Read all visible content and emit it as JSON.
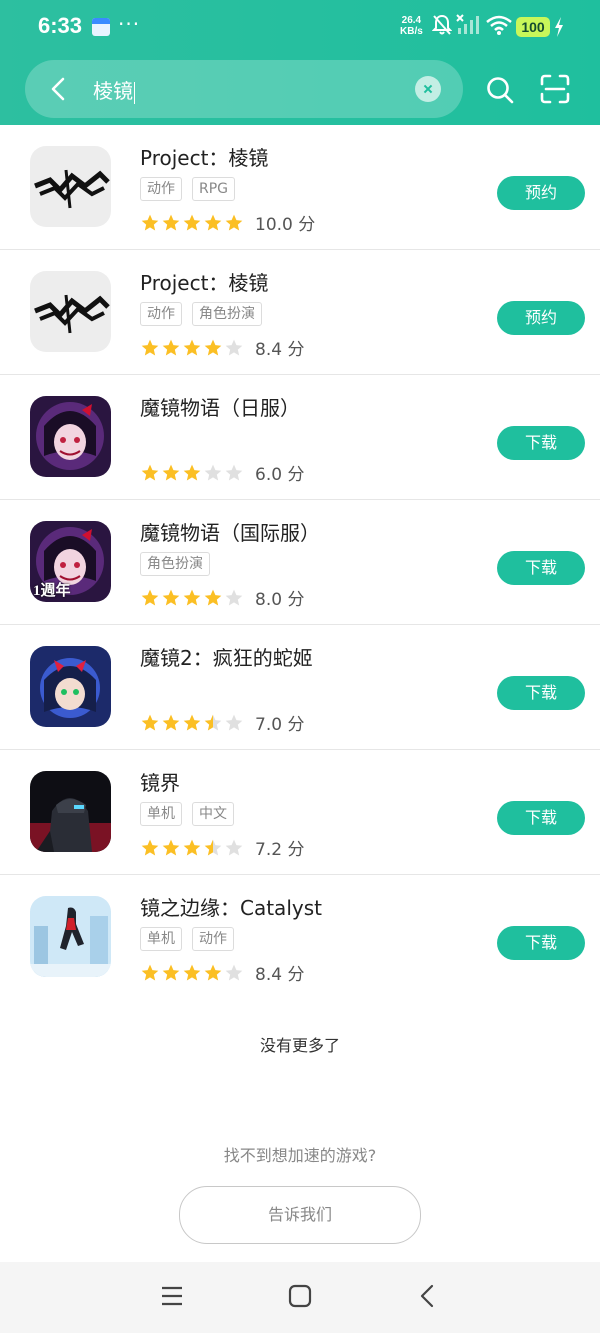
{
  "status_bar": {
    "time": "6:33",
    "more": "···",
    "net_speed_value": "26.4",
    "net_speed_unit": "KB/s",
    "battery": "100"
  },
  "search": {
    "query": "棱镜"
  },
  "results": [
    {
      "name": "Project：棱镜",
      "tags": [
        "动作",
        "RPG"
      ],
      "stars": 5,
      "score": "10.0 分",
      "action": "预约",
      "icon": "prism-logo-icon"
    },
    {
      "name": "Project：棱镜",
      "tags": [
        "动作",
        "角色扮演"
      ],
      "stars": 4,
      "score": "8.4 分",
      "action": "预约",
      "icon": "prism-logo-icon"
    },
    {
      "name": "魔镜物语（日服）",
      "tags": [],
      "stars": 3,
      "score": "6.0 分",
      "action": "下载",
      "icon": "mirror-tale-icon"
    },
    {
      "name": "魔镜物语（国际服）",
      "tags": [
        "角色扮演"
      ],
      "stars": 4,
      "score": "8.0 分",
      "action": "下载",
      "icon": "mirror-tale-anniversary-icon"
    },
    {
      "name": "魔镜2：疯狂的蛇姬",
      "tags": [],
      "stars": 3.5,
      "score": "7.0 分",
      "action": "下载",
      "icon": "mirror2-icon"
    },
    {
      "name": "镜界",
      "tags": [
        "单机",
        "中文"
      ],
      "stars": 3.5,
      "score": "7.2 分",
      "action": "下载",
      "icon": "mirror-realm-icon"
    },
    {
      "name": "镜之边缘：Catalyst",
      "tags": [
        "单机",
        "动作"
      ],
      "stars": 4,
      "score": "8.4 分",
      "action": "下载",
      "icon": "mirrors-edge-icon"
    }
  ],
  "footer": {
    "no_more": "没有更多了",
    "cannot_find": "找不到想加速的游戏?",
    "tell_us": "告诉我们"
  },
  "icon_overlay_text": "1週年",
  "colors": {
    "accent": "#1fbf9e",
    "star": "#fbbf24",
    "star_empty": "#e0e0e0"
  }
}
